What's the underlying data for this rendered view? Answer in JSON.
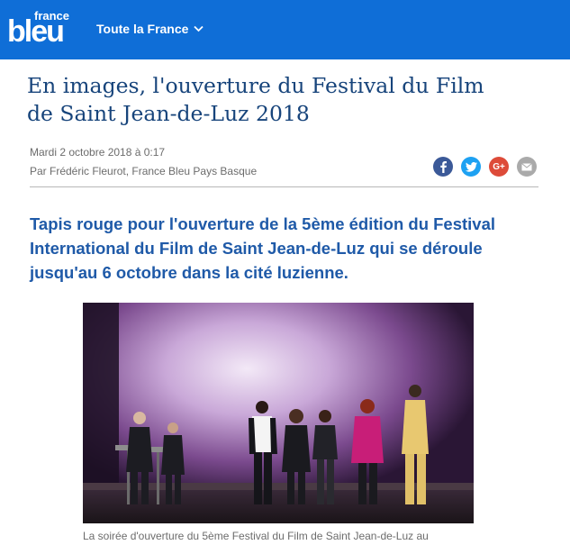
{
  "header": {
    "logo_small": "france",
    "logo_large": "bleu",
    "nav_label": "Toute la France",
    "brand_color": "#0f6ed7"
  },
  "article": {
    "title": "En images, l'ouverture du Festival du Film de Saint Jean-de-Luz 2018",
    "date": "Mardi 2 octobre 2018 à 0:17",
    "author": "Par Frédéric Fleurot, France Bleu Pays Basque",
    "lead": "Tapis rouge pour l'ouverture de la 5ème édition du Festival International du Film de Saint Jean-de-Luz qui se déroule jusqu'au 6 octobre dans la cité luzienne.",
    "caption": "La soirée d'ouverture du 5ème Festival du Film de Saint Jean-de-Luz au"
  },
  "share": {
    "facebook": "f",
    "twitter": "t",
    "google": "G+",
    "email": "mail",
    "icons": [
      "facebook-icon",
      "twitter-icon",
      "google-plus-icon",
      "email-icon"
    ]
  }
}
